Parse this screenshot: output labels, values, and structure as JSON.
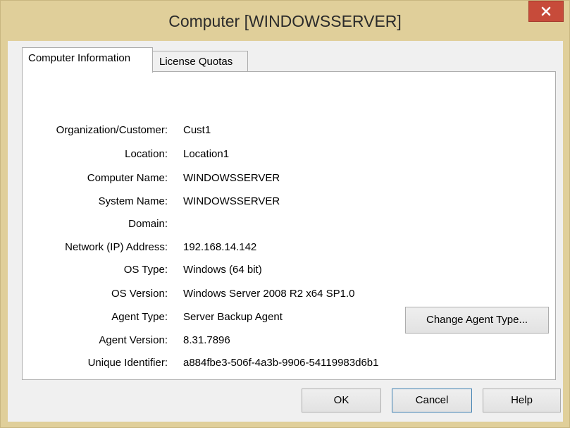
{
  "window": {
    "title": "Computer [WINDOWSSERVER]",
    "close_glyph": "x"
  },
  "tabs": [
    {
      "label": "Computer Information",
      "active": true
    },
    {
      "label": "License Quotas",
      "active": false
    }
  ],
  "fields": [
    {
      "label": "Organization/Customer:",
      "value": "Cust1"
    },
    {
      "label": "Location:",
      "value": "Location1"
    },
    {
      "label": "Computer Name:",
      "value": "WINDOWSSERVER"
    },
    {
      "label": "System Name:",
      "value": "WINDOWSSERVER"
    },
    {
      "label": "Domain:",
      "value": ""
    },
    {
      "label": "Network (IP) Address:",
      "value": "192.168.14.142"
    },
    {
      "label": "OS Type:",
      "value": "Windows (64 bit)"
    },
    {
      "label": "OS Version:",
      "value": "Windows Server 2008 R2 x64 SP1.0"
    },
    {
      "label": "Agent Type:",
      "value": "Server Backup Agent"
    },
    {
      "label": "Agent Version:",
      "value": "8.31.7896"
    },
    {
      "label": "Unique Identifier:",
      "value": "a884fbe3-506f-4a3b-9906-54119983d6b1"
    }
  ],
  "buttons": {
    "change_agent_type": "Change Agent Type...",
    "ok": "OK",
    "cancel": "Cancel",
    "help": "Help"
  },
  "colors": {
    "title_bar": "#e0cf9a",
    "close_button": "#c74b3a",
    "client_background": "#f0f0f0",
    "panel_background": "#ffffff"
  }
}
